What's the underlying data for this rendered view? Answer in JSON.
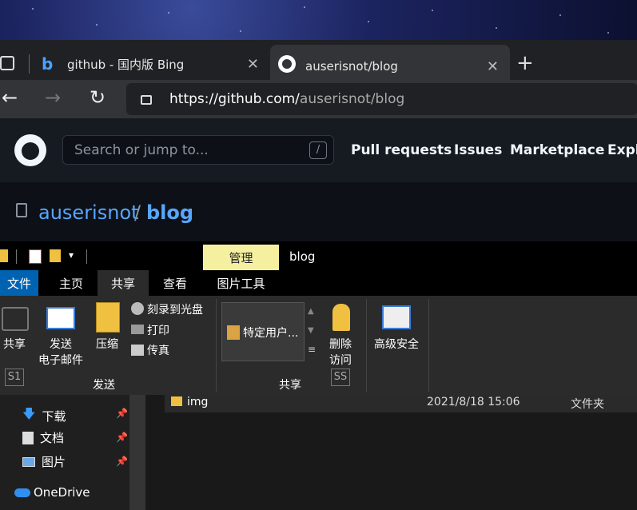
{
  "browser": {
    "tabs": [
      {
        "title": "github - 国内版 Bing"
      },
      {
        "title": "auserisnot/blog"
      }
    ],
    "address": {
      "prefix": "https://github.com/",
      "path": "auserisnot/blog"
    }
  },
  "github": {
    "search_placeholder": "Search or jump to...",
    "search_key": "/",
    "nav": [
      "Pull requests",
      "Issues",
      "Marketplace",
      "Explo"
    ],
    "owner": "auserisnot",
    "separator": "/",
    "repo": "blog"
  },
  "explorer": {
    "context_label": "管理",
    "window_title": "blog",
    "tabs": [
      "文件",
      "主页",
      "共享",
      "查看",
      "图片工具"
    ],
    "ribbon": {
      "share": "共享",
      "share_key": "S1",
      "email_line1": "发送",
      "email_line2": "电子邮件",
      "zip": "压缩",
      "burn": "刻录到光盘",
      "print": "打印",
      "fax": "传真",
      "group_send": "发送",
      "specific_user": "特定用户...",
      "remove_line1": "删除",
      "remove_line2": "访问",
      "remove_key": "SS",
      "group_share": "共享",
      "advanced_security": "高级安全"
    },
    "nav_items": [
      "下载",
      "文档",
      "图片",
      "OneDrive"
    ],
    "files": [
      {
        "name": "img",
        "date": "2021/8/18 15:06",
        "type": "文件夹"
      }
    ]
  }
}
